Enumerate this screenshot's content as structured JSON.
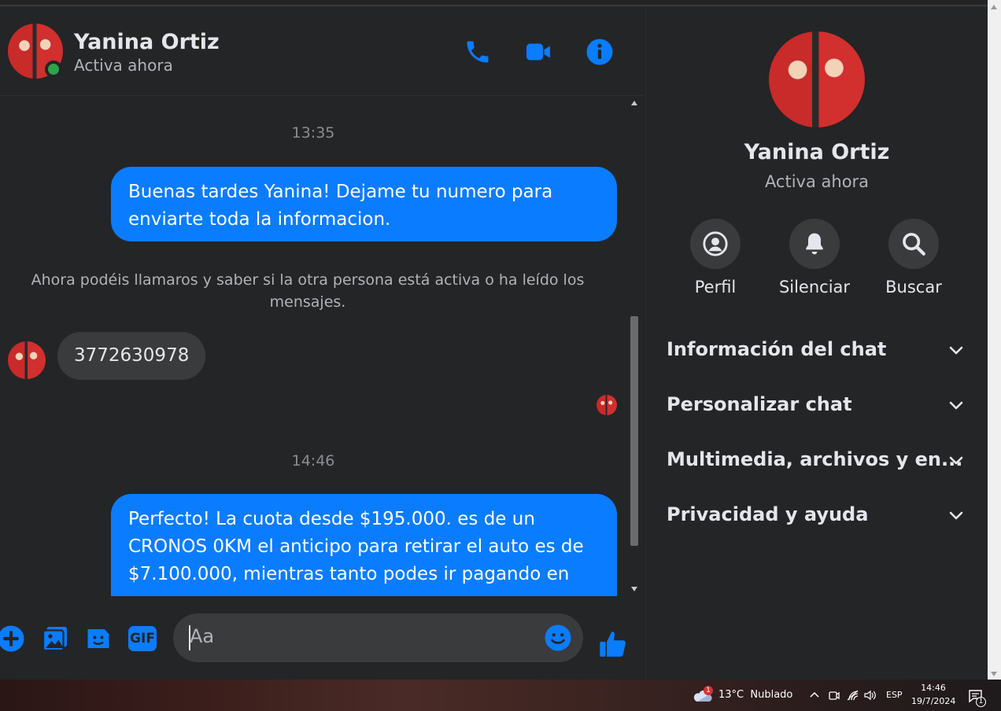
{
  "header": {
    "contact_name": "Yanina Ortiz",
    "status": "Activa ahora",
    "icons": [
      "phone-icon",
      "video-call-icon",
      "info-icon"
    ]
  },
  "messages": {
    "time_1": "13:35",
    "outgoing_1": "Buenas tardes Yanina! Dejame tu numero para enviarte toda la informacion.",
    "system_note": "Ahora podéis llamaros y saber si la otra persona está activa o ha leído los mensajes.",
    "incoming_1": "3772630978",
    "time_2": "14:46",
    "outgoing_2": "Perfecto! La cuota desde $195.000. es de un CRONOS 0KM el anticipo para retirar el auto es de $7.100.000, mientras tanto podes ir pagando en"
  },
  "composer": {
    "placeholder": "Aa",
    "icons": [
      "add-icon",
      "photo-icon",
      "sticker-icon",
      "gif-icon",
      "emoji-icon",
      "like-icon"
    ],
    "gif_label": "GIF"
  },
  "panel": {
    "contact_name": "Yanina Ortiz",
    "status": "Activa ahora",
    "actions": [
      {
        "label": "Perfil",
        "icon": "profile-icon"
      },
      {
        "label": "Silenciar",
        "icon": "bell-icon"
      },
      {
        "label": "Buscar",
        "icon": "search-icon"
      }
    ],
    "sections": [
      "Información del chat",
      "Personalizar chat",
      "Multimedia, archivos y en...",
      "Privacidad y ayuda"
    ]
  },
  "taskbar": {
    "weather_badge": "1",
    "weather": "13°C  Nublado",
    "language": "ESP",
    "time": "14:46",
    "date": "19/7/2024",
    "notification_count": "1"
  },
  "colors": {
    "accent": "#0a7cff",
    "background": "#242526",
    "bubble_in": "#3a3b3c",
    "online": "#31a24c"
  }
}
